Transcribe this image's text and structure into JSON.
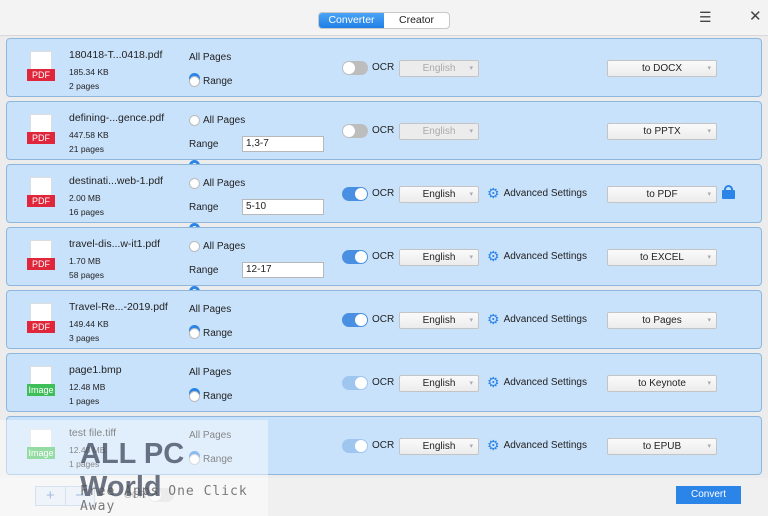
{
  "header": {
    "tabs": [
      {
        "label": "Converter",
        "active": true
      },
      {
        "label": "Creator",
        "active": false
      }
    ],
    "menu_icon": "hamburger-icon",
    "close_icon": "close-icon"
  },
  "colors": {
    "accent": "#2b84e8",
    "row_bg": "#c9e2fb",
    "pdf": "#e0263b",
    "image": "#3fbf5a"
  },
  "labels": {
    "all_pages": "All Pages",
    "range": "Range",
    "ocr": "OCR",
    "advanced": "Advanced Settings"
  },
  "files": [
    {
      "name": "180418-T...0418.pdf",
      "size": "185.34 KB",
      "pages": "2 pages",
      "type": "PDF",
      "page_mode": "all",
      "range": "",
      "ocr": "off",
      "language": "English",
      "lang_enabled": false,
      "advanced": false,
      "format": "to DOCX",
      "lock": false
    },
    {
      "name": "defining-...gence.pdf",
      "size": "447.58 KB",
      "pages": "21 pages",
      "type": "PDF",
      "page_mode": "range",
      "range": "1,3-7",
      "ocr": "off",
      "language": "English",
      "lang_enabled": false,
      "advanced": false,
      "format": "to PPTX",
      "lock": false
    },
    {
      "name": "destinati...web-1.pdf",
      "size": "2.00 MB",
      "pages": "16 pages",
      "type": "PDF",
      "page_mode": "range",
      "range": "5-10",
      "ocr": "on",
      "language": "English",
      "lang_enabled": true,
      "advanced": true,
      "format": "to PDF",
      "lock": true
    },
    {
      "name": "travel-dis...w-it1.pdf",
      "size": "1.70 MB",
      "pages": "58 pages",
      "type": "PDF",
      "page_mode": "range",
      "range": "12-17",
      "ocr": "on",
      "language": "English",
      "lang_enabled": true,
      "advanced": true,
      "format": "to EXCEL",
      "lock": false
    },
    {
      "name": "Travel-Re...-2019.pdf",
      "size": "149.44 KB",
      "pages": "3 pages",
      "type": "PDF",
      "page_mode": "all",
      "range": "",
      "ocr": "on",
      "language": "English",
      "lang_enabled": true,
      "advanced": true,
      "format": "to Pages",
      "lock": false
    },
    {
      "name": "page1.bmp",
      "size": "12.48 MB",
      "pages": "1 pages",
      "type": "Image",
      "page_mode": "all",
      "range": "",
      "ocr": "dim",
      "language": "English",
      "lang_enabled": true,
      "advanced": true,
      "format": "to Keynote",
      "lock": false
    },
    {
      "name": "test file.tiff",
      "size": "12.48 MB",
      "pages": "1 pages",
      "type": "Image",
      "page_mode": "all",
      "range": "",
      "ocr": "dim",
      "language": "English",
      "lang_enabled": true,
      "advanced": true,
      "format": "to EPUB",
      "lock": false
    }
  ],
  "footer": {
    "add": "+",
    "remove": "−",
    "ocr_label": "OCR",
    "convert": "Convert"
  },
  "watermark": {
    "title": "ALL PC World",
    "subtitle": "Free Apps One Click Away"
  }
}
